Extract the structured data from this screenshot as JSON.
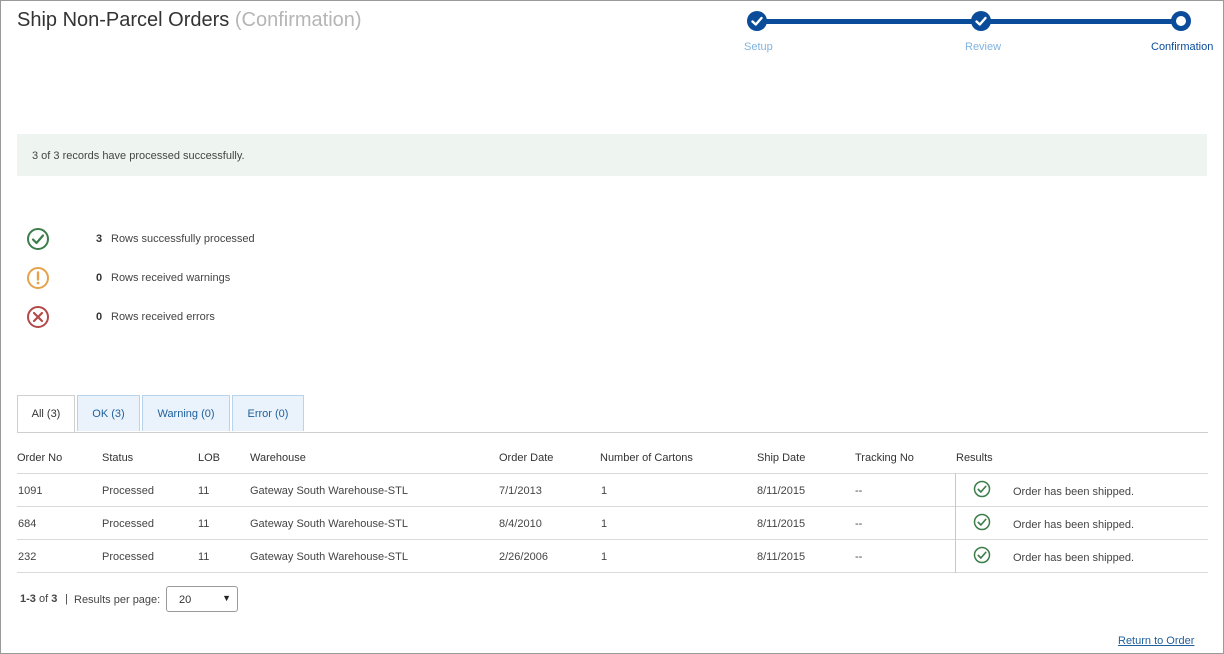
{
  "header": {
    "title": "Ship Non-Parcel Orders",
    "subtitle": "(Confirmation)"
  },
  "stepper": {
    "steps": [
      {
        "label": "Setup",
        "state": "done"
      },
      {
        "label": "Review",
        "state": "done"
      },
      {
        "label": "Confirmation",
        "state": "current"
      }
    ]
  },
  "alert": {
    "message": "3 of 3 records have processed successfully."
  },
  "summary": [
    {
      "icon": "check-circle-icon",
      "count": "3",
      "text": "Rows successfully processed",
      "color": "#3c7d4a"
    },
    {
      "icon": "warning-circle-icon",
      "count": "0",
      "text": "Rows received warnings",
      "color": "#e5a24b"
    },
    {
      "icon": "error-circle-icon",
      "count": "0",
      "text": "Rows received errors",
      "color": "#b24a4a"
    }
  ],
  "tabs": [
    {
      "label": "All (3)",
      "active": true
    },
    {
      "label": "OK (3)",
      "active": false
    },
    {
      "label": "Warning (0)",
      "active": false
    },
    {
      "label": "Error (0)",
      "active": false
    }
  ],
  "table": {
    "columns": [
      "Order No",
      "Status",
      "LOB",
      "Warehouse",
      "Order Date",
      "Number of Cartons",
      "Ship Date",
      "Tracking No",
      "Results"
    ],
    "rows": [
      {
        "order_no": "1091",
        "status": "Processed",
        "lob": "11",
        "warehouse": "Gateway South Warehouse-STL",
        "order_date": "7/1/2013",
        "cartons": "1",
        "ship_date": "8/11/2015",
        "tracking": "--",
        "result": "Order has been shipped."
      },
      {
        "order_no": "684",
        "status": "Processed",
        "lob": "11",
        "warehouse": "Gateway South Warehouse-STL",
        "order_date": "8/4/2010",
        "cartons": "1",
        "ship_date": "8/11/2015",
        "tracking": "--",
        "result": "Order has been shipped."
      },
      {
        "order_no": "232",
        "status": "Processed",
        "lob": "11",
        "warehouse": "Gateway South Warehouse-STL",
        "order_date": "2/26/2006",
        "cartons": "1",
        "ship_date": "8/11/2015",
        "tracking": "--",
        "result": "Order has been shipped."
      }
    ]
  },
  "pager": {
    "range": "1-3",
    "of_label": "of",
    "total": "3",
    "separator": "|",
    "results_per_page_label": "Results per page:",
    "per_page": "20"
  },
  "footer": {
    "return_link": "Return to Order"
  },
  "colors": {
    "primary": "#0b4c9a",
    "success": "#3c7d4a",
    "warning": "#e5a24b",
    "error": "#b24a4a",
    "link": "#1f5f9e"
  }
}
